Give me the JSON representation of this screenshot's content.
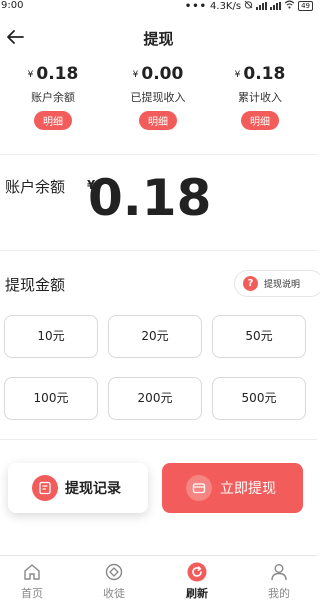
{
  "status_bar": {
    "time": "9:00",
    "dots": "•••",
    "speed": "4.3K/s",
    "battery": "49"
  },
  "header": {
    "title": "提现"
  },
  "stats": [
    {
      "yen": "¥",
      "amount": "0.18",
      "label": "账户余额",
      "detail": "明细"
    },
    {
      "yen": "¥",
      "amount": "0.00",
      "label": "已提现收入",
      "detail": "明细"
    },
    {
      "yen": "¥",
      "amount": "0.18",
      "label": "累计收入",
      "detail": "明细"
    }
  ],
  "balance": {
    "label": "账户余额",
    "yen": "¥",
    "value": "0.18"
  },
  "withdraw_amount": {
    "title": "提现金额",
    "explain_icon": "?",
    "explain_label": "提现说明",
    "options": [
      "10元",
      "20元",
      "50元",
      "100元",
      "200元",
      "500元"
    ]
  },
  "actions": {
    "records_label": "提现记录",
    "withdraw_label": "立即提现"
  },
  "nav": [
    {
      "label": "首页",
      "icon": "home-icon"
    },
    {
      "label": "收徒",
      "icon": "recruit-icon"
    },
    {
      "label": "刷新",
      "icon": "refresh-icon"
    },
    {
      "label": "我的",
      "icon": "profile-icon"
    }
  ],
  "colors": {
    "accent": "#f25c5a"
  }
}
